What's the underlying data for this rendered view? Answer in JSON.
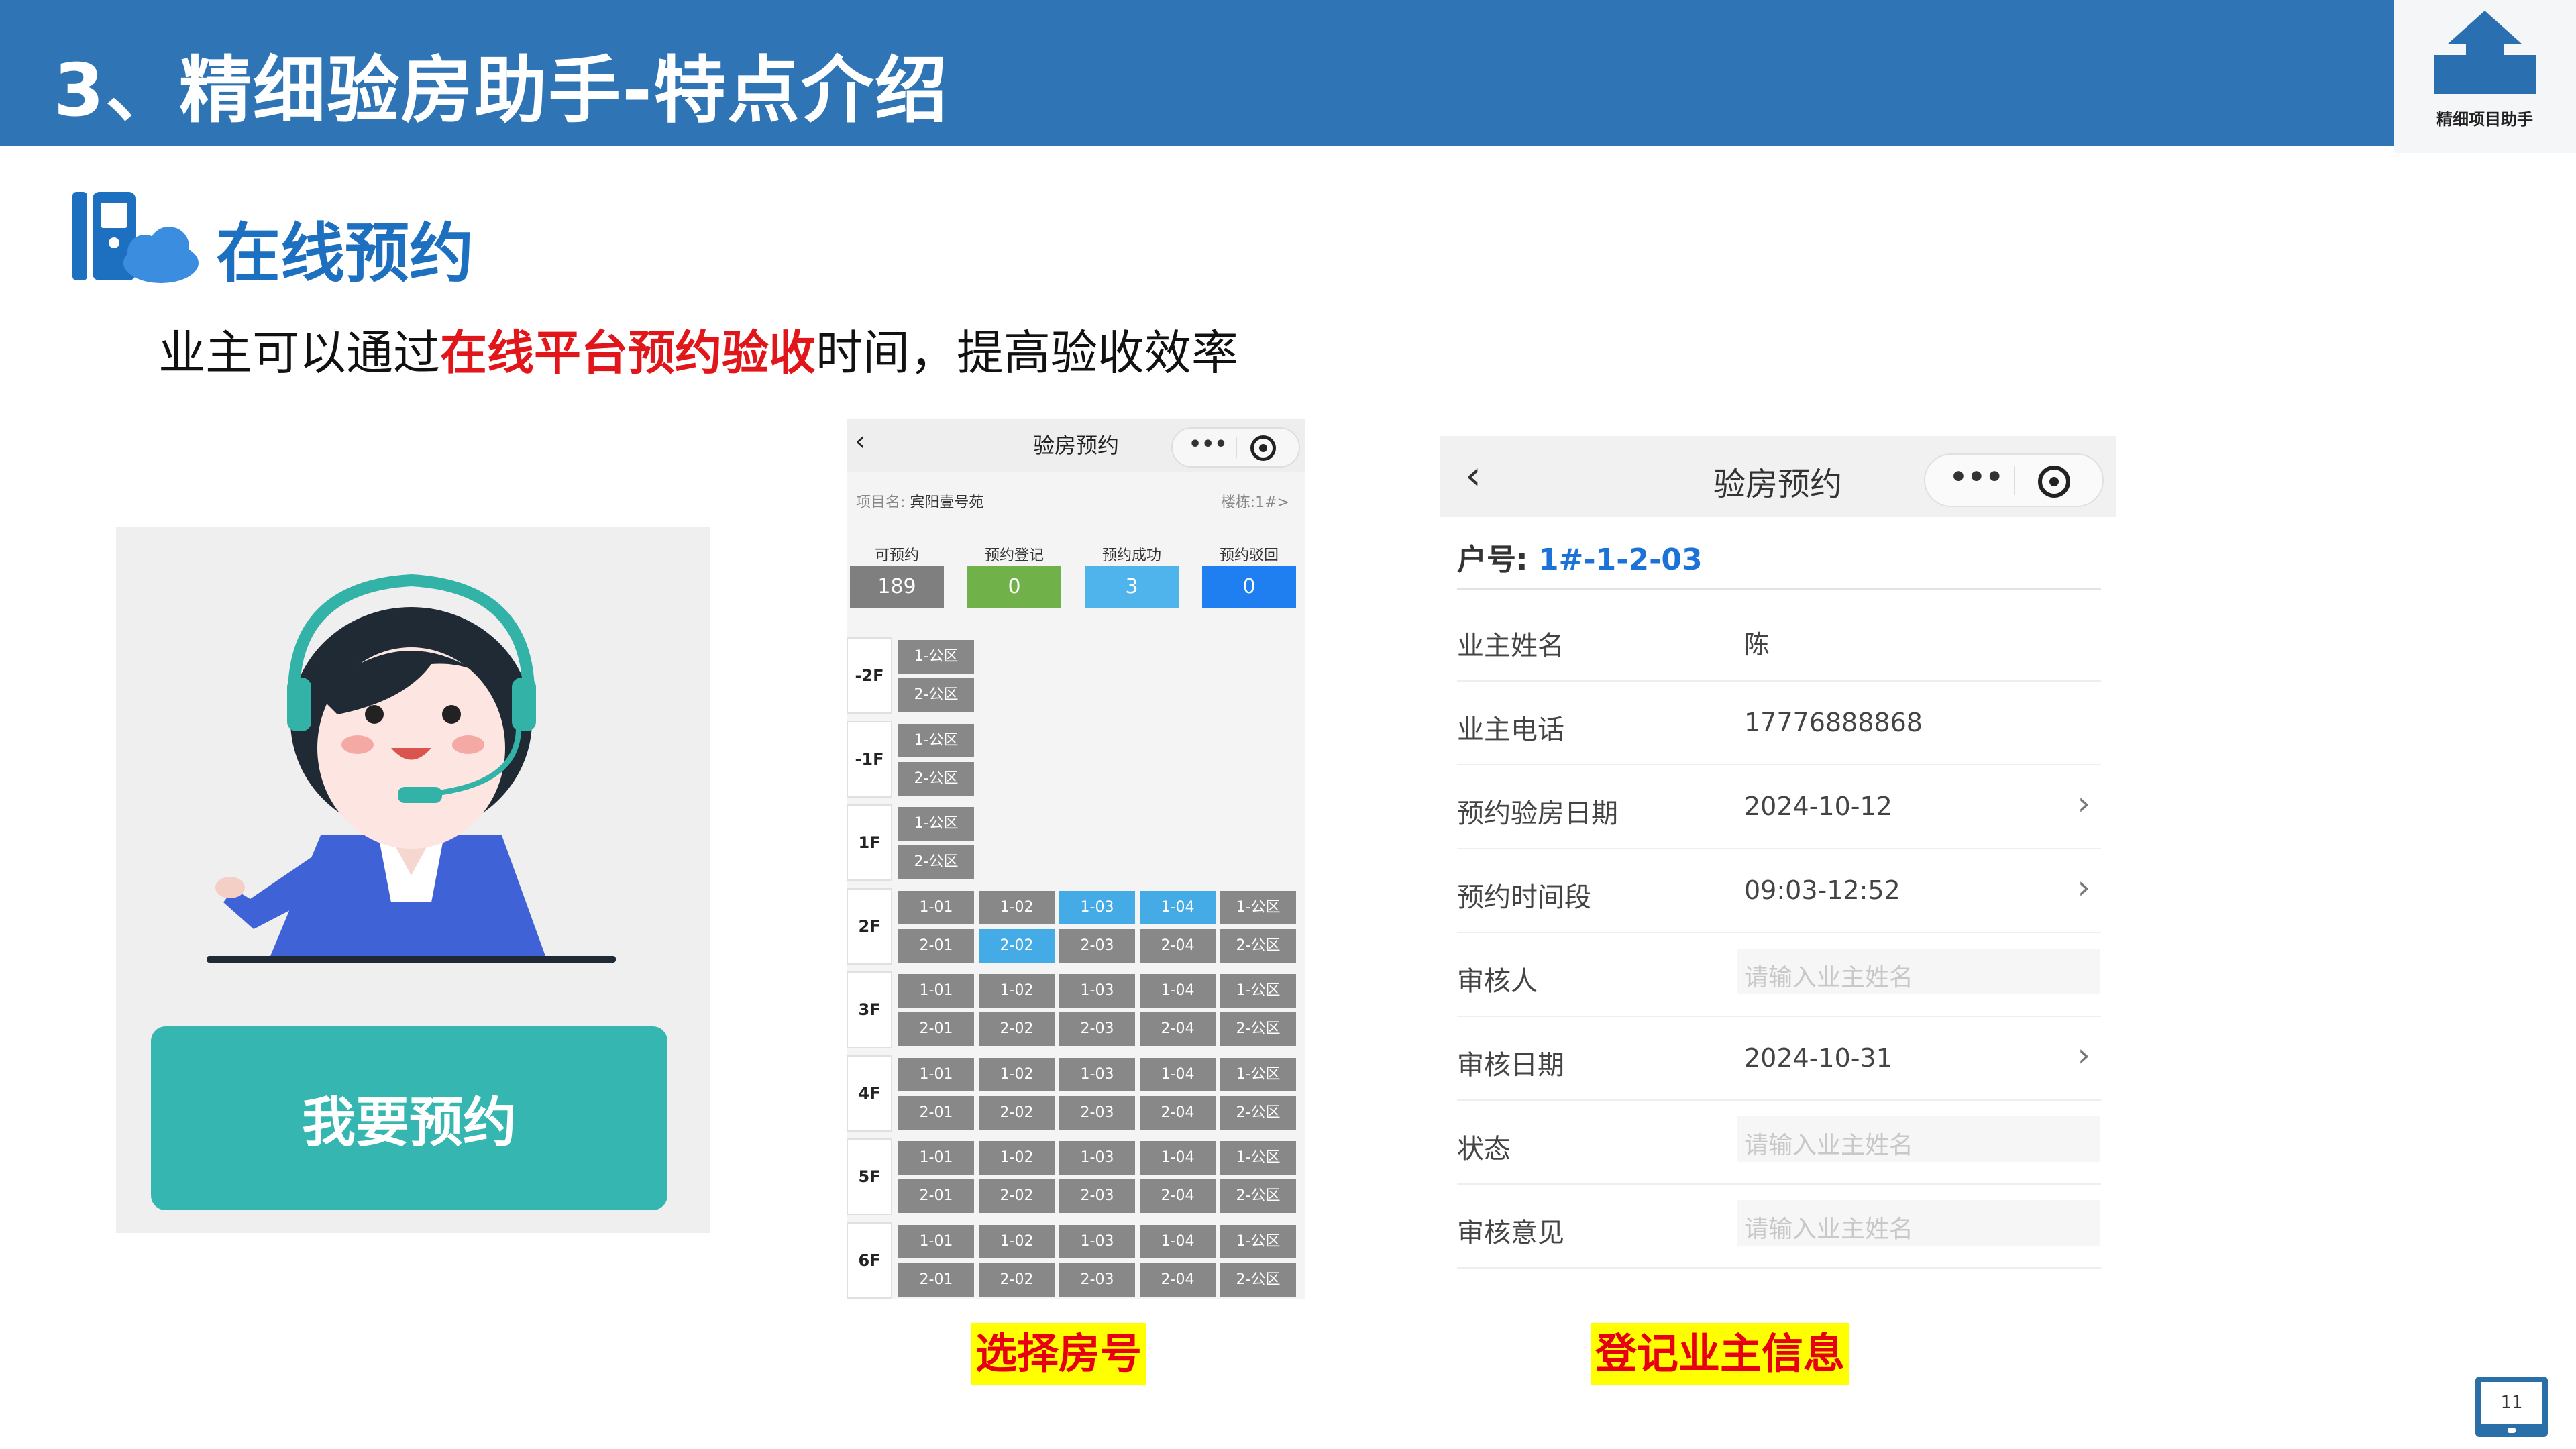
{
  "header": {
    "title": "3、精细验房助手-特点介绍"
  },
  "logo": {
    "text": "精细项目助手"
  },
  "section": {
    "title": "在线预约"
  },
  "description": {
    "before": "业主可以通过",
    "highlight": "在线平台预约验收",
    "after": "时间，提高验收效率"
  },
  "panel_left": {
    "button_label": "我要预约"
  },
  "phone_rooms": {
    "title": "验房预约",
    "project_label": "项目名:",
    "project_name": "宾阳壹号苑",
    "building": "楼栋:1#>",
    "stats": [
      {
        "label": "可预约",
        "value": "189",
        "color": "#7f7f7f"
      },
      {
        "label": "预约登记",
        "value": "0",
        "color": "#71b14a"
      },
      {
        "label": "预约成功",
        "value": "3",
        "color": "#4fb4ec"
      },
      {
        "label": "预约驳回",
        "value": "0",
        "color": "#1f7ff0"
      }
    ],
    "floors": [
      {
        "label": "-2F",
        "top": [
          "1-公区"
        ],
        "bottom": [
          "2-公区"
        ]
      },
      {
        "label": "-1F",
        "top": [
          "1-公区"
        ],
        "bottom": [
          "2-公区"
        ]
      },
      {
        "label": "1F",
        "top": [
          "1-公区"
        ],
        "bottom": [
          "2-公区"
        ]
      },
      {
        "label": "2F",
        "top": [
          "1-01",
          "1-02",
          "1-03",
          "1-04",
          "1-公区"
        ],
        "bottom": [
          "2-01",
          "2-02",
          "2-03",
          "2-04",
          "2-公区"
        ]
      },
      {
        "label": "3F",
        "top": [
          "1-01",
          "1-02",
          "1-03",
          "1-04",
          "1-公区"
        ],
        "bottom": [
          "2-01",
          "2-02",
          "2-03",
          "2-04",
          "2-公区"
        ]
      },
      {
        "label": "4F",
        "top": [
          "1-01",
          "1-02",
          "1-03",
          "1-04",
          "1-公区"
        ],
        "bottom": [
          "2-01",
          "2-02",
          "2-03",
          "2-04",
          "2-公区"
        ]
      },
      {
        "label": "5F",
        "top": [
          "1-01",
          "1-02",
          "1-03",
          "1-04",
          "1-公区"
        ],
        "bottom": [
          "2-01",
          "2-02",
          "2-03",
          "2-04",
          "2-公区"
        ]
      },
      {
        "label": "6F",
        "top": [
          "1-01",
          "1-02",
          "1-03",
          "1-04",
          "1-公区"
        ],
        "bottom": [
          "2-01",
          "2-02",
          "2-03",
          "2-04",
          "2-公区"
        ]
      }
    ],
    "highlighted_rooms": [
      "2F:1-03",
      "2F:1-04",
      "2F:2-02"
    ],
    "caption": "选择房号"
  },
  "phone_form": {
    "title": "验房预约",
    "room_label": "户号:",
    "room_value": "1#-1-2-03",
    "fields": [
      {
        "label": "业主姓名",
        "value": "陈",
        "placeholder": "",
        "arrow": false
      },
      {
        "label": "业主电话",
        "value": "17776888868",
        "placeholder": "",
        "arrow": false
      },
      {
        "label": "预约验房日期",
        "value": "2024-10-12",
        "placeholder": "",
        "arrow": true
      },
      {
        "label": "预约时间段",
        "value": "09:03-12:52",
        "placeholder": "",
        "arrow": true
      },
      {
        "label": "审核人",
        "value": "",
        "placeholder": "请输入业主姓名",
        "arrow": false
      },
      {
        "label": "审核日期",
        "value": "2024-10-31",
        "placeholder": "",
        "arrow": true
      },
      {
        "label": "状态",
        "value": "",
        "placeholder": "请输入业主姓名",
        "arrow": false
      },
      {
        "label": "审核意见",
        "value": "",
        "placeholder": "请输入业主姓名",
        "arrow": false
      }
    ],
    "caption": "登记业主信息"
  },
  "page_number": "11"
}
